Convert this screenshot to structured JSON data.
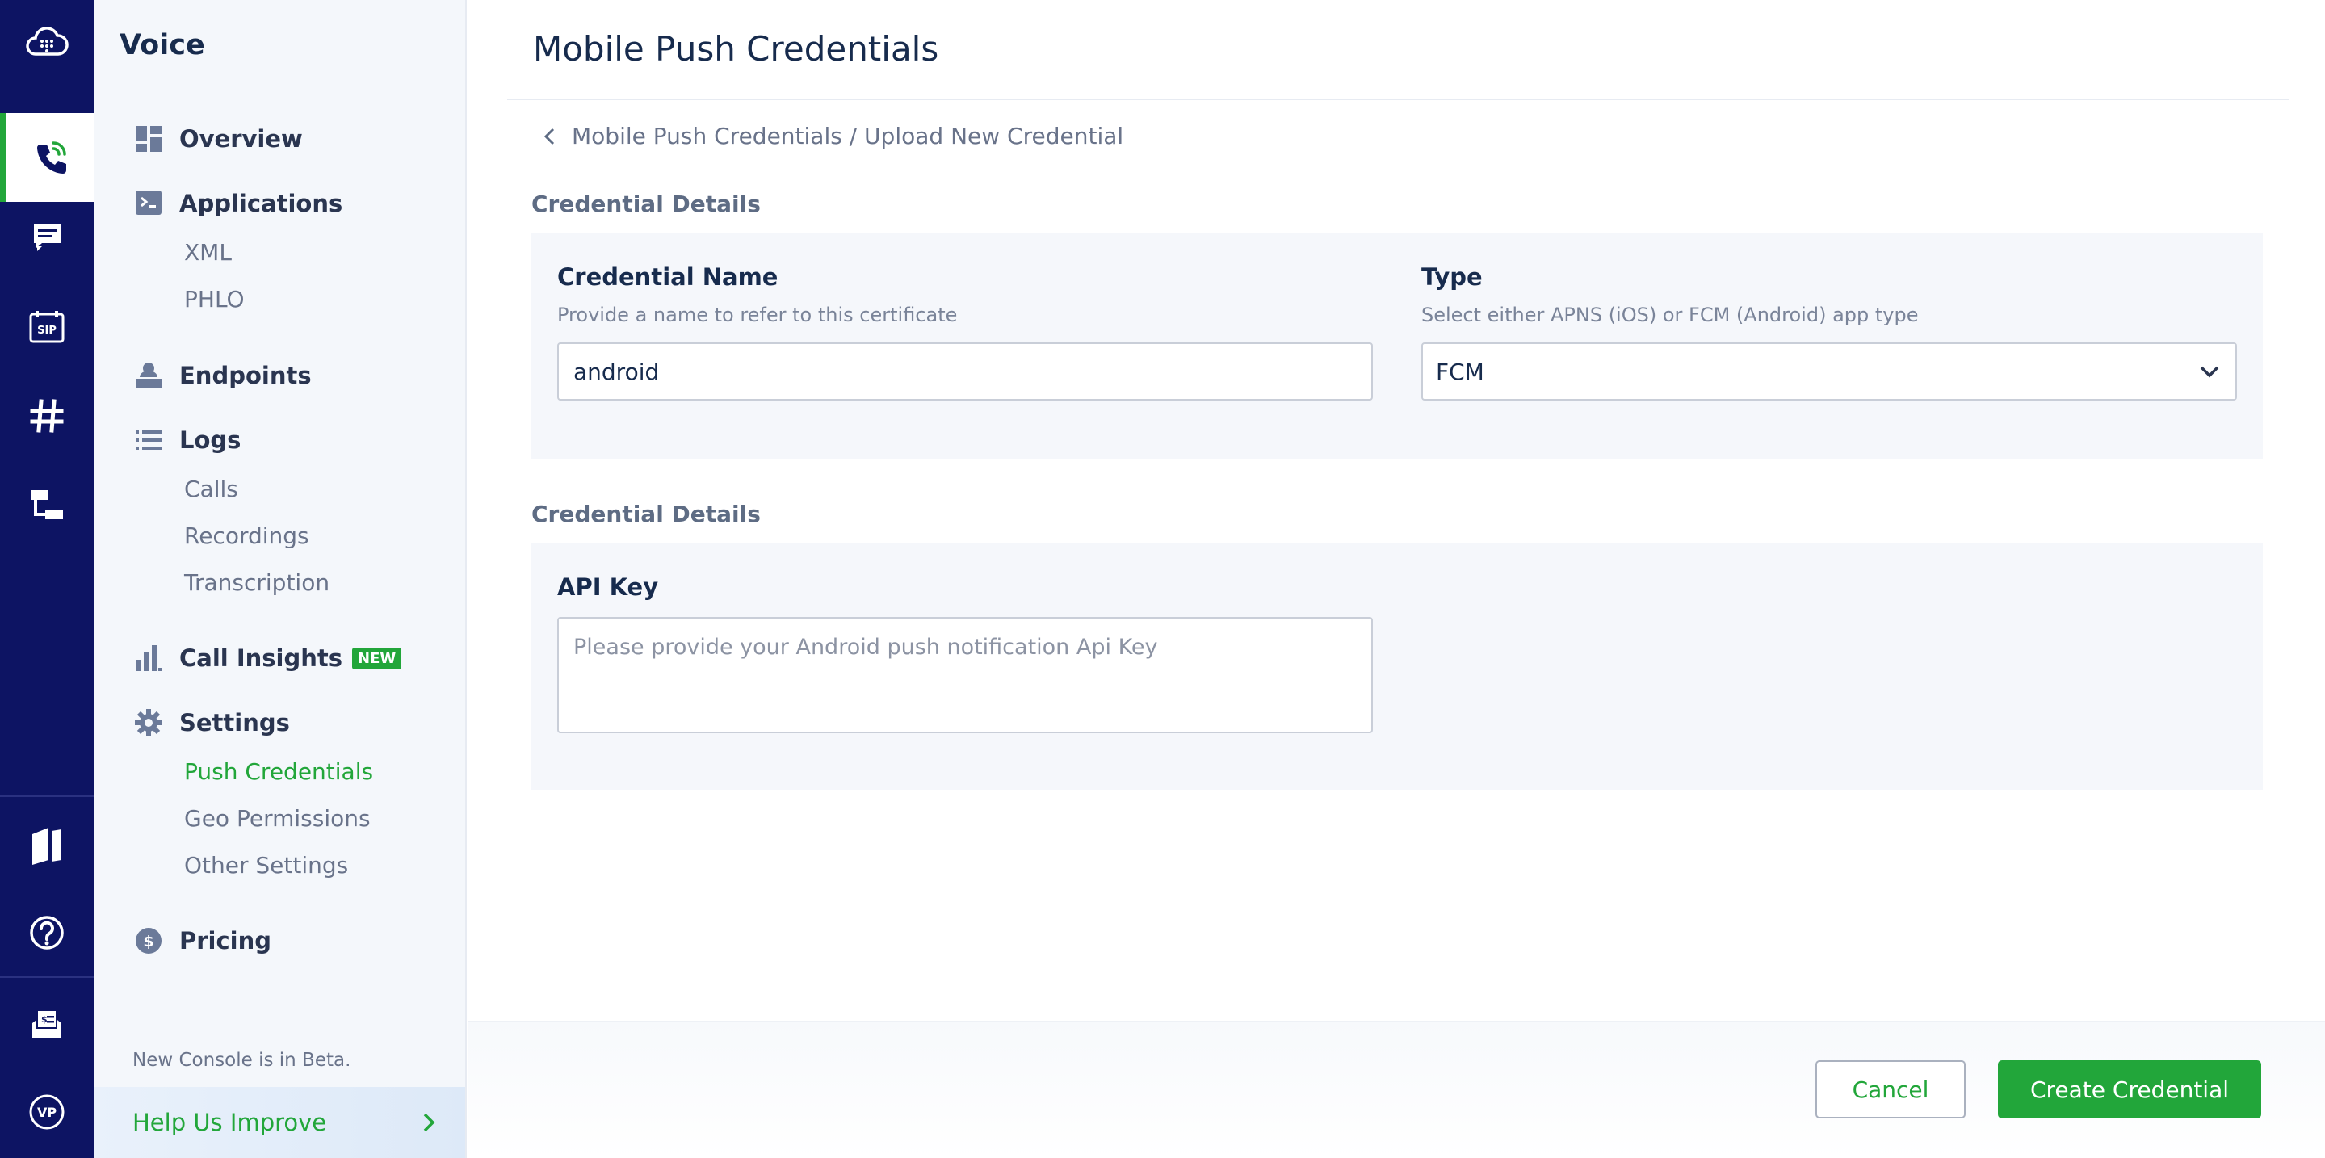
{
  "sidebar": {
    "title": "Voice",
    "nav": {
      "overview": "Overview",
      "applications": "Applications",
      "xml": "XML",
      "phlo": "PHLO",
      "endpoints": "Endpoints",
      "logs": "Logs",
      "calls": "Calls",
      "recordings": "Recordings",
      "transcription": "Transcription",
      "call_insights": "Call Insights",
      "call_insights_badge": "NEW",
      "settings": "Settings",
      "push_credentials": "Push Credentials",
      "geo_permissions": "Geo Permissions",
      "other_settings": "Other Settings",
      "pricing": "Pricing"
    },
    "beta_note": "New Console is in Beta.",
    "help_improve": "Help Us Improve"
  },
  "header": {
    "title": "Mobile Push Credentials"
  },
  "breadcrumb": "Mobile Push Credentials / Upload New Credential",
  "section1": {
    "label": "Credential Details",
    "credential_name": {
      "label": "Credential Name",
      "help": "Provide a name to refer to this certificate",
      "value": "android"
    },
    "type": {
      "label": "Type",
      "help": "Select either APNS (iOS) or FCM (Android) app type",
      "value": "FCM"
    }
  },
  "section2": {
    "label": "Credential Details",
    "api_key": {
      "label": "API Key",
      "placeholder": "Please provide your Android push notification Api Key"
    }
  },
  "footer": {
    "cancel": "Cancel",
    "create": "Create Credential"
  },
  "colors": {
    "rail": "#0d1463",
    "accent": "#22a63a",
    "sidebar_bg": "#f4f7fb",
    "panel_bg": "#f5f7fb"
  }
}
